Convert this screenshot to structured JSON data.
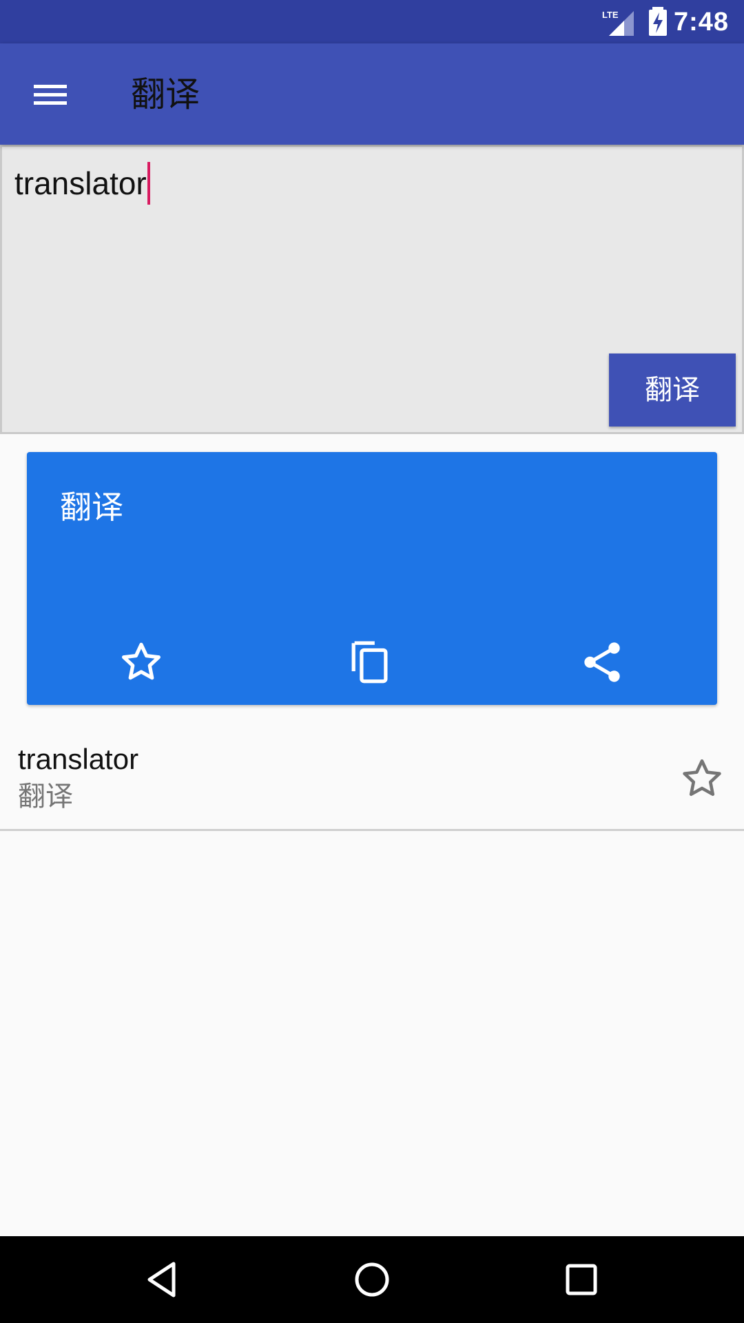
{
  "status_bar": {
    "network": "LTE",
    "time": "7:48",
    "icons": [
      "lte-signal-icon",
      "battery-charging-icon"
    ]
  },
  "app_bar": {
    "title": "翻译",
    "menu_icon": "hamburger-menu-icon"
  },
  "input": {
    "value": "translator",
    "button_label": "翻译"
  },
  "result_card": {
    "text": "翻译",
    "background_color": "#1e75e6",
    "actions": [
      {
        "name": "favorite",
        "icon": "star-outline-icon"
      },
      {
        "name": "copy",
        "icon": "copy-icon"
      },
      {
        "name": "share",
        "icon": "share-icon"
      }
    ]
  },
  "history": [
    {
      "word": "translator",
      "translation": "翻译",
      "icon": "star-outline-icon"
    }
  ],
  "nav_bar": {
    "icons": [
      "back-icon",
      "home-icon",
      "recents-icon"
    ]
  },
  "colors": {
    "primary": "#3f51b5",
    "primary_dark": "#303f9f",
    "accent_caret": "#d81b60"
  }
}
